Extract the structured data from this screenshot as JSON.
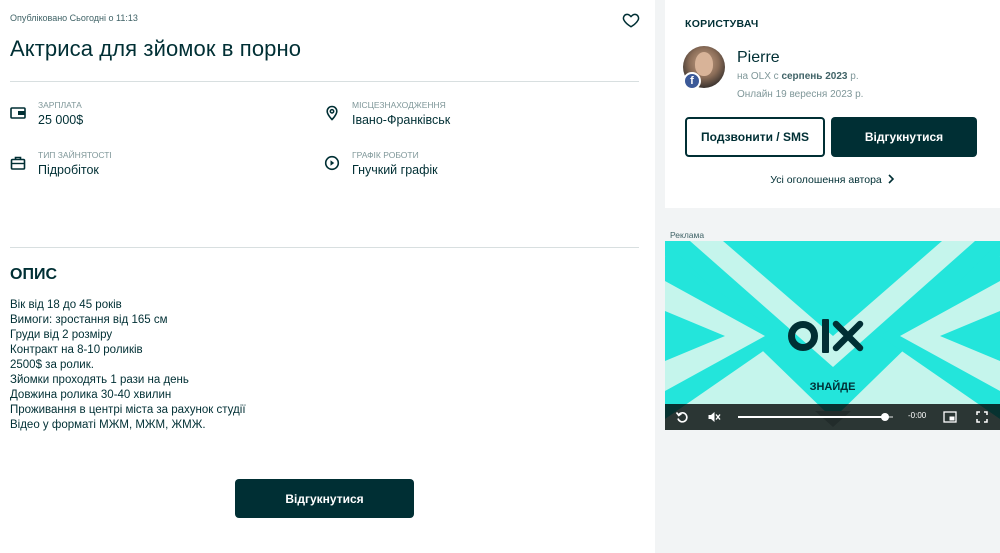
{
  "listing": {
    "published": "Опубліковано Сьогодні о 11:13",
    "title": "Актриса для зйомок в порно",
    "params": {
      "salary_label": "ЗАРПЛАТА",
      "salary_value": "25 000$",
      "location_label": "МІСЦЕЗНАХОДЖЕННЯ",
      "location_value": "Івано-Франківськ",
      "employment_label": "ТИП ЗАЙНЯТОСТІ",
      "employment_value": "Підробіток",
      "schedule_label": "ГРАФІК РОБОТИ",
      "schedule_value": "Гнучкий графік"
    },
    "description_heading": "ОПИС",
    "description_lines": [
      "Вік від 18 до 45 років",
      "Вимоги: зростання від 165 см",
      "Груди від 2 розміру",
      "Контракт на 8-10 роликів",
      "2500$ за ролик.",
      "Зйомки проходять 1 рази на день",
      "Довжина ролика 30-40 хвилин",
      "Проживання в центрі міста за рахунок студії",
      "Відео у форматі МЖМ, МЖМ, ЖМЖ."
    ],
    "respond_button": "Відгукнутися"
  },
  "user": {
    "heading": "КОРИСТУВАЧ",
    "name": "Pierre",
    "since_prefix": "на OLX с",
    "since_value": "серпень 2023",
    "since_suffix": "р.",
    "online": "Онлайн 19 вересня 2023 р.",
    "call_button": "Подзвонити / SMS",
    "respond_button": "Відгукнутися",
    "all_ads": "Усі оголошення автора"
  },
  "ad": {
    "label": "Реклама",
    "logo": "OLX",
    "tagline": "ЗНАЙДЕ",
    "time": "-0:00",
    "progress": 0.95
  },
  "colors": {
    "brand_dark": "#002f34",
    "ad_teal": "#23e5db",
    "ad_mint": "#c5f5ec"
  },
  "icons": {
    "favorite": "heart-icon",
    "salary": "wallet-icon",
    "location": "map-pin-icon",
    "employment": "briefcase-icon",
    "schedule": "clock-icon",
    "facebook": "facebook-icon",
    "chevron": "chevron-right-icon"
  }
}
